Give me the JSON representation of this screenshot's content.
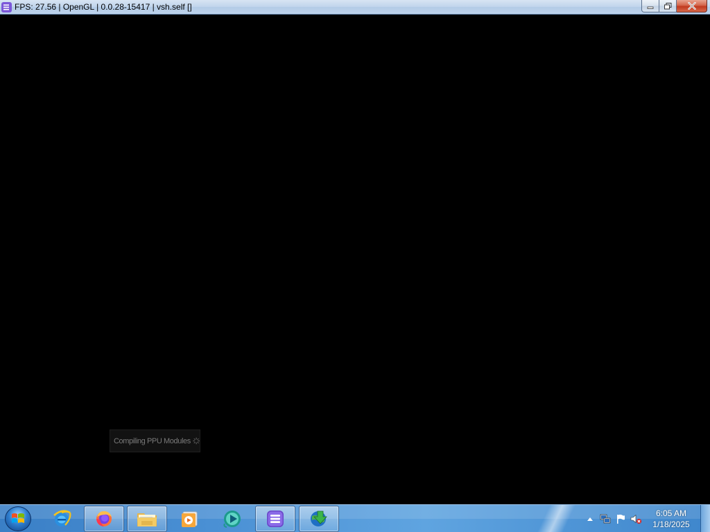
{
  "window": {
    "title": "FPS: 27.56 | OpenGL | 0.0.28-15417 | vsh.self []",
    "icon": "rpcs3-icon",
    "controls": {
      "minimize": "minimize-icon",
      "maximize": "restore-icon",
      "close": "close-icon"
    }
  },
  "content": {
    "background": "#000000",
    "toast": {
      "text": "Compiling PPU Modules",
      "icon": "spinner-icon"
    }
  },
  "taskbar": {
    "start_icon": "windows-logo-icon",
    "items": [
      {
        "name": "internet-explorer",
        "icon": "internet-explorer-icon",
        "active": false
      },
      {
        "name": "firefox",
        "icon": "firefox-icon",
        "active": true
      },
      {
        "name": "file-explorer",
        "icon": "folder-icon",
        "active": true
      },
      {
        "name": "media-player",
        "icon": "media-player-icon",
        "active": false
      },
      {
        "name": "media-app",
        "icon": "play-globe-icon",
        "active": false
      },
      {
        "name": "rpcs3",
        "icon": "rpcs3-icon",
        "active": true
      },
      {
        "name": "download-manager",
        "icon": "download-globe-icon",
        "active": true
      }
    ],
    "tray": {
      "icons": [
        "show-hidden-icons-arrow",
        "network-icon",
        "action-center-flag-icon",
        "volume-muted-icon"
      ],
      "time": "6:05 AM",
      "date": "1/18/2025"
    }
  },
  "colors": {
    "titlebar": "#c1d5ec",
    "taskbar": "#4a90d4",
    "rpcs3_accent": "#7b57d9",
    "toast_bg": "#121212",
    "toast_text": "#7a7a7a"
  }
}
